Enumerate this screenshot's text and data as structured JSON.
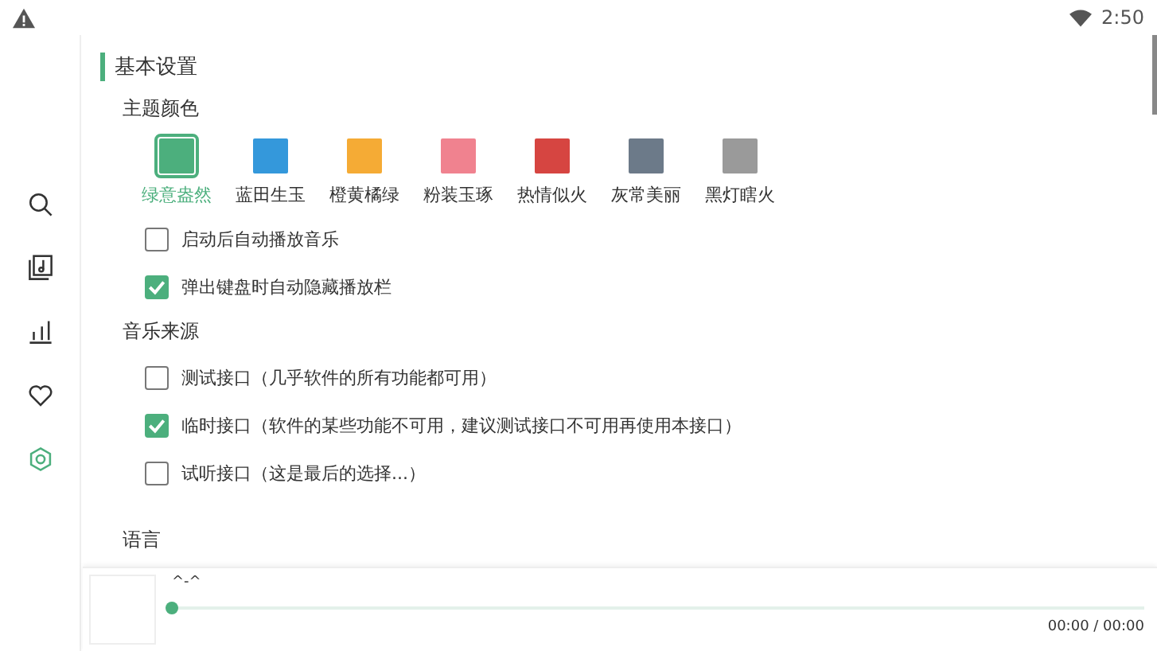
{
  "status_bar": {
    "time": "2:50"
  },
  "nav": [
    {
      "kind": "search",
      "selected": false
    },
    {
      "kind": "music",
      "selected": false
    },
    {
      "kind": "chart",
      "selected": false
    },
    {
      "kind": "heart",
      "selected": false
    },
    {
      "kind": "settings",
      "selected": true
    }
  ],
  "section_title": "基本设置",
  "theme": {
    "label": "主题颜色",
    "options": [
      {
        "name": "绿意盎然",
        "color": "#4caf7d",
        "selected": true
      },
      {
        "name": "蓝田生玉",
        "color": "#3498db",
        "selected": false
      },
      {
        "name": "橙黄橘绿",
        "color": "#f5ab35",
        "selected": false
      },
      {
        "name": "粉装玉琢",
        "color": "#f0828f",
        "selected": false
      },
      {
        "name": "热情似火",
        "color": "#d64541",
        "selected": false
      },
      {
        "name": "灰常美丽",
        "color": "#6c7a89",
        "selected": false
      },
      {
        "name": "黑灯瞎火",
        "color": "#9a9a9a",
        "selected": false
      }
    ]
  },
  "options": [
    {
      "label": "启动后自动播放音乐",
      "checked": false
    },
    {
      "label": "弹出键盘时自动隐藏播放栏",
      "checked": true
    }
  ],
  "source": {
    "label": "音乐来源",
    "items": [
      {
        "label": "测试接口（几乎软件的所有功能都可用）",
        "checked": false
      },
      {
        "label": "临时接口（软件的某些功能不可用，建议测试接口不可用再使用本接口）",
        "checked": true
      },
      {
        "label": "试听接口（这是最后的选择...）",
        "checked": false
      }
    ]
  },
  "language_label": "语言",
  "player": {
    "title": "^-^",
    "level": 0,
    "time": "00:00 / 00:00"
  }
}
